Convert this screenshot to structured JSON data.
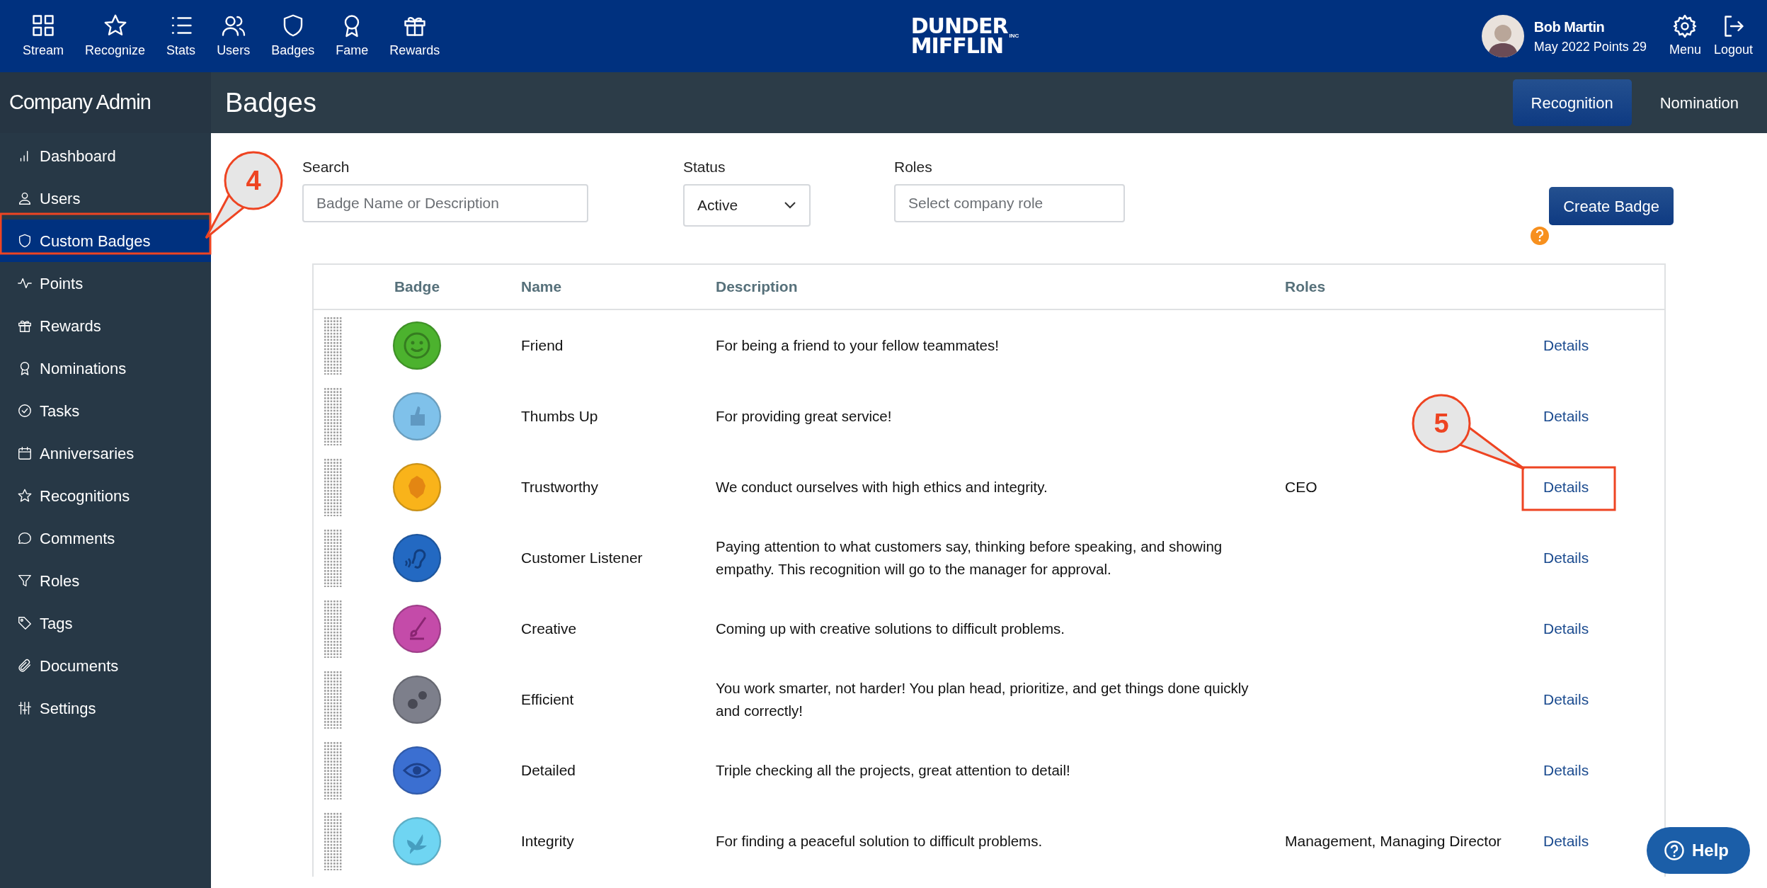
{
  "top_nav": {
    "items": [
      {
        "label": "Stream",
        "kind": "grid"
      },
      {
        "label": "Recognize",
        "kind": "star"
      },
      {
        "label": "Stats",
        "kind": "list"
      },
      {
        "label": "Users",
        "kind": "people"
      },
      {
        "label": "Badges",
        "kind": "shield"
      },
      {
        "label": "Fame",
        "kind": "award"
      },
      {
        "label": "Rewards",
        "kind": "gift"
      }
    ]
  },
  "logo": {
    "line_1": "DUNDER",
    "line_2": "MIFFLIN",
    "suffix": "INC"
  },
  "user": {
    "name": "Bob Martin",
    "points": "May 2022 Points 29"
  },
  "user_actions": [
    {
      "label": "Menu",
      "kind": "gear"
    },
    {
      "label": "Logout",
      "kind": "logout"
    }
  ],
  "sidebar": {
    "title": "Company Admin",
    "items": [
      {
        "label": "Dashboard",
        "kind": "bars",
        "selected": false
      },
      {
        "label": "Users",
        "kind": "person",
        "selected": false
      },
      {
        "label": "Custom Badges",
        "kind": "shield",
        "selected": true
      },
      {
        "label": "Points",
        "kind": "pulse",
        "selected": false
      },
      {
        "label": "Rewards",
        "kind": "gift",
        "selected": false
      },
      {
        "label": "Nominations",
        "kind": "award",
        "selected": false
      },
      {
        "label": "Tasks",
        "kind": "check",
        "selected": false
      },
      {
        "label": "Anniversaries",
        "kind": "calendar",
        "selected": false
      },
      {
        "label": "Recognitions",
        "kind": "star",
        "selected": false
      },
      {
        "label": "Comments",
        "kind": "chat",
        "selected": false
      },
      {
        "label": "Roles",
        "kind": "funnel",
        "selected": false
      },
      {
        "label": "Tags",
        "kind": "tag",
        "selected": false
      },
      {
        "label": "Documents",
        "kind": "clip",
        "selected": false
      },
      {
        "label": "Settings",
        "kind": "sliders",
        "selected": false
      }
    ]
  },
  "page_title": "Badges",
  "tabs": [
    {
      "label": "Recognition",
      "selected": true
    },
    {
      "label": "Nomination",
      "selected": false
    }
  ],
  "filters": {
    "search": {
      "label": "Search",
      "placeholder": "Badge Name or Description"
    },
    "status": {
      "label": "Status",
      "value": "Active"
    },
    "roles": {
      "label": "Roles",
      "placeholder": "Select company role"
    }
  },
  "create_button": "Create Badge",
  "table": {
    "columns": [
      "Badge",
      "Name",
      "Description",
      "Roles"
    ],
    "rows": [
      {
        "kind": "smiley",
        "color": "#4cb22e",
        "name": "Friend",
        "description": "For being a friend to your fellow teammates!",
        "link": "Details"
      },
      {
        "kind": "thumb",
        "color": "#7fc1ea",
        "name": "Thumbs Up",
        "description": "For providing great service!",
        "link": "Details"
      },
      {
        "kind": "lion",
        "color": "#f9b31a",
        "name": "Trustworthy",
        "description": "We conduct ourselves with high ethics and integrity.",
        "roles": "CEO",
        "link": "Details"
      },
      {
        "kind": "ear",
        "color": "#2369c2",
        "name": "Customer Listener",
        "description": "Paying attention to what customers say, thinking before speaking, and showing empathy. This recognition will go to the manager for approval.",
        "link": "Details"
      },
      {
        "kind": "brush",
        "color": "#c44ba9",
        "name": "Creative",
        "description": "Coming up with creative solutions to difficult problems.",
        "link": "Details"
      },
      {
        "kind": "gears",
        "color": "#7d7f8b",
        "name": "Efficient",
        "description": "You work smarter, not harder! You plan head, prioritize, and get things done quickly and correctly!",
        "link": "Details"
      },
      {
        "kind": "eye",
        "color": "#3b6fd1",
        "name": "Detailed",
        "description": "Triple checking all the projects, great attention to detail!",
        "link": "Details"
      },
      {
        "kind": "dove",
        "color": "#6fd5f2",
        "name": "Integrity",
        "description": "For finding a peaceful solution to difficult problems.",
        "roles": "Management, Managing Director",
        "link": "Details"
      }
    ]
  },
  "help_button": "Help",
  "annotations": [
    {
      "number": "4"
    },
    {
      "number": "5"
    }
  ]
}
